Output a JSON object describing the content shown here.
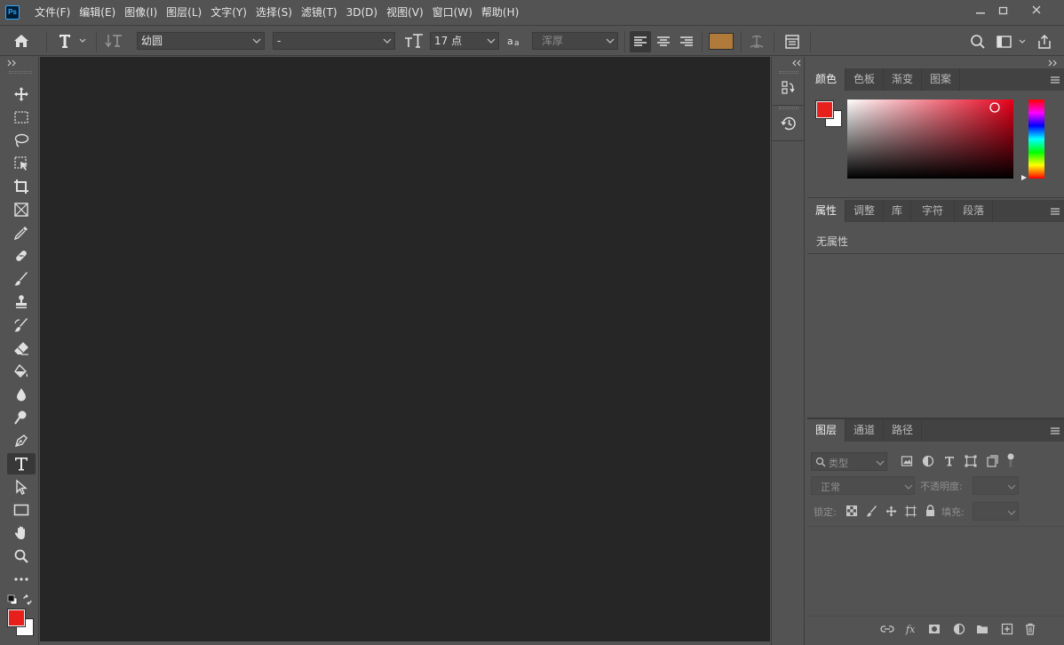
{
  "app": {
    "logo_text": "Ps"
  },
  "menu": [
    "文件(F)",
    "编辑(E)",
    "图像(I)",
    "图层(L)",
    "文字(Y)",
    "选择(S)",
    "滤镜(T)",
    "3D(D)",
    "视图(V)",
    "窗口(W)",
    "帮助(H)"
  ],
  "options_bar": {
    "font_family": "幼圆",
    "font_style": "-",
    "font_size": "17 点",
    "antialias": "浑厚",
    "text_color": "#b07a3a"
  },
  "colors": {
    "foreground": "#e8201c",
    "background": "#ffffff"
  },
  "color_panel": {
    "tabs": [
      "颜色",
      "色板",
      "渐变",
      "图案"
    ],
    "active_tab": "颜色",
    "hue_base": "#e8001a"
  },
  "properties_panel": {
    "tabs": [
      "属性",
      "调整",
      "库",
      "字符",
      "段落"
    ],
    "active_tab": "属性",
    "empty_text": "无属性"
  },
  "layers_panel": {
    "tabs": [
      "图层",
      "通道",
      "路径"
    ],
    "active_tab": "图层",
    "filter_placeholder": "类型",
    "blend_mode": "正常",
    "opacity_label": "不透明度:",
    "lock_label": "锁定:",
    "fill_label": "填充:"
  }
}
